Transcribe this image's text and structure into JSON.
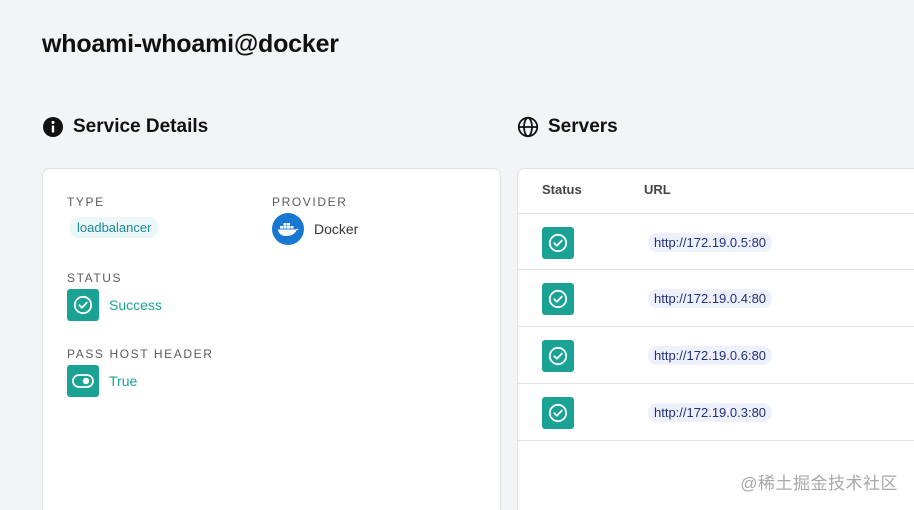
{
  "page": {
    "title": "whoami-whoami@docker"
  },
  "details": {
    "heading": "Service Details",
    "heading_icon": "info-circle-icon",
    "type_label": "TYPE",
    "type_value": "loadbalancer",
    "provider_label": "PROVIDER",
    "provider_value": "Docker",
    "provider_icon": "docker-whale-icon",
    "status_label": "STATUS",
    "status_value": "Success",
    "pass_host_label": "PASS HOST HEADER",
    "pass_host_value": "True"
  },
  "servers": {
    "heading": "Servers",
    "heading_icon": "globe-icon",
    "columns": {
      "status": "Status",
      "url": "URL"
    },
    "rows": [
      {
        "url": "http://172.19.0.5:80",
        "status": "success"
      },
      {
        "url": "http://172.19.0.4:80",
        "status": "success"
      },
      {
        "url": "http://172.19.0.6:80",
        "status": "success"
      },
      {
        "url": "http://172.19.0.3:80",
        "status": "success"
      }
    ]
  },
  "watermark": "@稀土掘金技术社区",
  "colors": {
    "success": "#1aa394",
    "chip_bg": "#eaf6f8",
    "chip_text": "#1f8a9c",
    "url_chip_bg": "#eef0fb",
    "url_chip_text": "#20307a",
    "docker_blue": "#1877d1",
    "background": "#f3f4f6"
  }
}
